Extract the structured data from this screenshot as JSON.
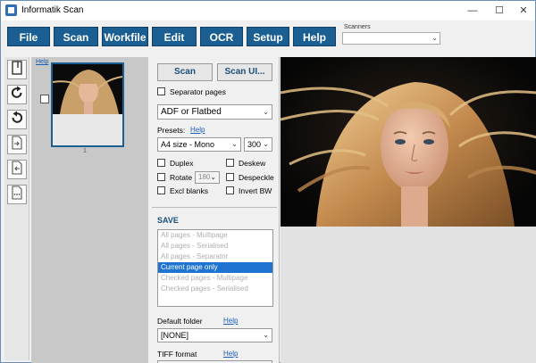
{
  "window": {
    "title": "Informatik Scan",
    "controls": [
      "—",
      "☐",
      "✕"
    ]
  },
  "menu": {
    "items": [
      "File",
      "Scan",
      "Workfile",
      "Edit",
      "OCR",
      "Setup",
      "Help"
    ],
    "scanners_label": "Scanners",
    "scanners_value": ""
  },
  "left_toolbar": {
    "icons": [
      "new-page-icon",
      "rotate-right-icon",
      "rotate-left-icon",
      "export-page-icon",
      "import-page-icon",
      "more-icon"
    ]
  },
  "thumbnails": {
    "help_label": "Help",
    "page_number": "1"
  },
  "scan_panel": {
    "scan_label": "Scan",
    "scan_ui_label": "Scan UI...",
    "separator_pages_label": "Separator pages",
    "source_value": "ADF or Flatbed",
    "presets_label": "Presets:",
    "presets_help": "Help",
    "preset_value": "A4 size - Mono",
    "dpi_value": "300",
    "duplex_label": "Duplex",
    "deskew_label": "Deskew",
    "rotate_label": "Rotate",
    "rotate_value": "180",
    "despeckle_label": "Despeckle",
    "excl_blanks_label": "Excl blanks",
    "invert_bw_label": "Invert BW"
  },
  "save_panel": {
    "title": "SAVE",
    "options": [
      {
        "label": "All pages - Multipage",
        "selected": false
      },
      {
        "label": "All pages - Serialised",
        "selected": false
      },
      {
        "label": "All pages - Separator",
        "selected": false
      },
      {
        "label": "Current page only",
        "selected": true
      },
      {
        "label": "Checked pages - Multipage",
        "selected": false
      },
      {
        "label": "Checked pages - Serialised",
        "selected": false
      }
    ],
    "default_folder_label": "Default folder",
    "default_folder_help": "Help",
    "folder_value": "[NONE]",
    "tiff_format_label": "TIFF format",
    "tiff_format_help": "Help"
  },
  "colors": {
    "menu_button_bg": "#1b5f92",
    "selection": "#1f74d1",
    "link": "#1a5fb4"
  }
}
